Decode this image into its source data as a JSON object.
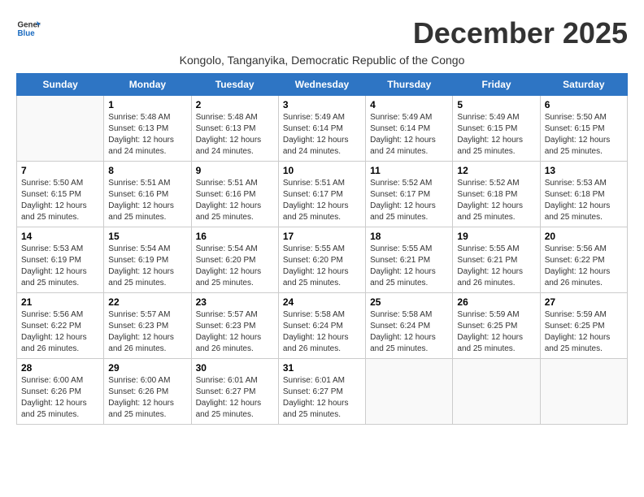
{
  "header": {
    "logo_line1": "General",
    "logo_line2": "Blue",
    "month_title": "December 2025",
    "subtitle": "Kongolo, Tanganyika, Democratic Republic of the Congo"
  },
  "weekdays": [
    "Sunday",
    "Monday",
    "Tuesday",
    "Wednesday",
    "Thursday",
    "Friday",
    "Saturday"
  ],
  "weeks": [
    [
      {
        "day": "",
        "sunrise": "",
        "sunset": "",
        "daylight": ""
      },
      {
        "day": "1",
        "sunrise": "Sunrise: 5:48 AM",
        "sunset": "Sunset: 6:13 PM",
        "daylight": "Daylight: 12 hours and 24 minutes."
      },
      {
        "day": "2",
        "sunrise": "Sunrise: 5:48 AM",
        "sunset": "Sunset: 6:13 PM",
        "daylight": "Daylight: 12 hours and 24 minutes."
      },
      {
        "day": "3",
        "sunrise": "Sunrise: 5:49 AM",
        "sunset": "Sunset: 6:14 PM",
        "daylight": "Daylight: 12 hours and 24 minutes."
      },
      {
        "day": "4",
        "sunrise": "Sunrise: 5:49 AM",
        "sunset": "Sunset: 6:14 PM",
        "daylight": "Daylight: 12 hours and 24 minutes."
      },
      {
        "day": "5",
        "sunrise": "Sunrise: 5:49 AM",
        "sunset": "Sunset: 6:15 PM",
        "daylight": "Daylight: 12 hours and 25 minutes."
      },
      {
        "day": "6",
        "sunrise": "Sunrise: 5:50 AM",
        "sunset": "Sunset: 6:15 PM",
        "daylight": "Daylight: 12 hours and 25 minutes."
      }
    ],
    [
      {
        "day": "7",
        "sunrise": "Sunrise: 5:50 AM",
        "sunset": "Sunset: 6:15 PM",
        "daylight": "Daylight: 12 hours and 25 minutes."
      },
      {
        "day": "8",
        "sunrise": "Sunrise: 5:51 AM",
        "sunset": "Sunset: 6:16 PM",
        "daylight": "Daylight: 12 hours and 25 minutes."
      },
      {
        "day": "9",
        "sunrise": "Sunrise: 5:51 AM",
        "sunset": "Sunset: 6:16 PM",
        "daylight": "Daylight: 12 hours and 25 minutes."
      },
      {
        "day": "10",
        "sunrise": "Sunrise: 5:51 AM",
        "sunset": "Sunset: 6:17 PM",
        "daylight": "Daylight: 12 hours and 25 minutes."
      },
      {
        "day": "11",
        "sunrise": "Sunrise: 5:52 AM",
        "sunset": "Sunset: 6:17 PM",
        "daylight": "Daylight: 12 hours and 25 minutes."
      },
      {
        "day": "12",
        "sunrise": "Sunrise: 5:52 AM",
        "sunset": "Sunset: 6:18 PM",
        "daylight": "Daylight: 12 hours and 25 minutes."
      },
      {
        "day": "13",
        "sunrise": "Sunrise: 5:53 AM",
        "sunset": "Sunset: 6:18 PM",
        "daylight": "Daylight: 12 hours and 25 minutes."
      }
    ],
    [
      {
        "day": "14",
        "sunrise": "Sunrise: 5:53 AM",
        "sunset": "Sunset: 6:19 PM",
        "daylight": "Daylight: 12 hours and 25 minutes."
      },
      {
        "day": "15",
        "sunrise": "Sunrise: 5:54 AM",
        "sunset": "Sunset: 6:19 PM",
        "daylight": "Daylight: 12 hours and 25 minutes."
      },
      {
        "day": "16",
        "sunrise": "Sunrise: 5:54 AM",
        "sunset": "Sunset: 6:20 PM",
        "daylight": "Daylight: 12 hours and 25 minutes."
      },
      {
        "day": "17",
        "sunrise": "Sunrise: 5:55 AM",
        "sunset": "Sunset: 6:20 PM",
        "daylight": "Daylight: 12 hours and 25 minutes."
      },
      {
        "day": "18",
        "sunrise": "Sunrise: 5:55 AM",
        "sunset": "Sunset: 6:21 PM",
        "daylight": "Daylight: 12 hours and 25 minutes."
      },
      {
        "day": "19",
        "sunrise": "Sunrise: 5:55 AM",
        "sunset": "Sunset: 6:21 PM",
        "daylight": "Daylight: 12 hours and 26 minutes."
      },
      {
        "day": "20",
        "sunrise": "Sunrise: 5:56 AM",
        "sunset": "Sunset: 6:22 PM",
        "daylight": "Daylight: 12 hours and 26 minutes."
      }
    ],
    [
      {
        "day": "21",
        "sunrise": "Sunrise: 5:56 AM",
        "sunset": "Sunset: 6:22 PM",
        "daylight": "Daylight: 12 hours and 26 minutes."
      },
      {
        "day": "22",
        "sunrise": "Sunrise: 5:57 AM",
        "sunset": "Sunset: 6:23 PM",
        "daylight": "Daylight: 12 hours and 26 minutes."
      },
      {
        "day": "23",
        "sunrise": "Sunrise: 5:57 AM",
        "sunset": "Sunset: 6:23 PM",
        "daylight": "Daylight: 12 hours and 26 minutes."
      },
      {
        "day": "24",
        "sunrise": "Sunrise: 5:58 AM",
        "sunset": "Sunset: 6:24 PM",
        "daylight": "Daylight: 12 hours and 26 minutes."
      },
      {
        "day": "25",
        "sunrise": "Sunrise: 5:58 AM",
        "sunset": "Sunset: 6:24 PM",
        "daylight": "Daylight: 12 hours and 25 minutes."
      },
      {
        "day": "26",
        "sunrise": "Sunrise: 5:59 AM",
        "sunset": "Sunset: 6:25 PM",
        "daylight": "Daylight: 12 hours and 25 minutes."
      },
      {
        "day": "27",
        "sunrise": "Sunrise: 5:59 AM",
        "sunset": "Sunset: 6:25 PM",
        "daylight": "Daylight: 12 hours and 25 minutes."
      }
    ],
    [
      {
        "day": "28",
        "sunrise": "Sunrise: 6:00 AM",
        "sunset": "Sunset: 6:26 PM",
        "daylight": "Daylight: 12 hours and 25 minutes."
      },
      {
        "day": "29",
        "sunrise": "Sunrise: 6:00 AM",
        "sunset": "Sunset: 6:26 PM",
        "daylight": "Daylight: 12 hours and 25 minutes."
      },
      {
        "day": "30",
        "sunrise": "Sunrise: 6:01 AM",
        "sunset": "Sunset: 6:27 PM",
        "daylight": "Daylight: 12 hours and 25 minutes."
      },
      {
        "day": "31",
        "sunrise": "Sunrise: 6:01 AM",
        "sunset": "Sunset: 6:27 PM",
        "daylight": "Daylight: 12 hours and 25 minutes."
      },
      {
        "day": "",
        "sunrise": "",
        "sunset": "",
        "daylight": ""
      },
      {
        "day": "",
        "sunrise": "",
        "sunset": "",
        "daylight": ""
      },
      {
        "day": "",
        "sunrise": "",
        "sunset": "",
        "daylight": ""
      }
    ]
  ]
}
